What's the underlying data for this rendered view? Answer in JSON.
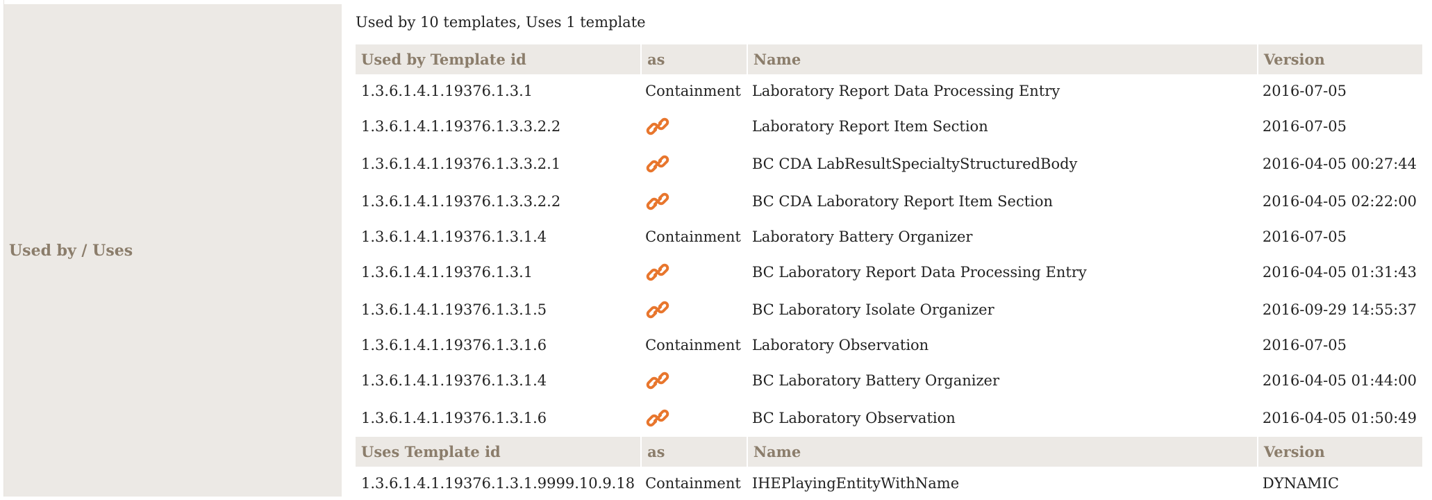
{
  "label": "Used by / Uses",
  "summary": "Used by 10 templates, Uses 1 template",
  "used_by": {
    "headers": [
      "Used by Template id",
      "as",
      "Name",
      "Version"
    ],
    "rows": [
      {
        "id": "1.3.6.1.4.1.19376.1.3.1",
        "as": "Containment",
        "icon": "",
        "name": "Laboratory Report Data Processing Entry",
        "version": "2016-07-05"
      },
      {
        "id": "1.3.6.1.4.1.19376.1.3.3.2.2",
        "as": "",
        "icon": "link-icon",
        "name": "Laboratory Report Item Section",
        "version": "2016-07-05"
      },
      {
        "id": "1.3.6.1.4.1.19376.1.3.3.2.1",
        "as": "",
        "icon": "link-icon",
        "name": "BC CDA LabResultSpecialtyStructuredBody",
        "version": "2016-04-05 00:27:44"
      },
      {
        "id": "1.3.6.1.4.1.19376.1.3.3.2.2",
        "as": "",
        "icon": "link-icon",
        "name": "BC CDA Laboratory Report Item Section",
        "version": "2016-04-05 02:22:00"
      },
      {
        "id": "1.3.6.1.4.1.19376.1.3.1.4",
        "as": "Containment",
        "icon": "",
        "name": "Laboratory Battery Organizer",
        "version": "2016-07-05"
      },
      {
        "id": "1.3.6.1.4.1.19376.1.3.1",
        "as": "",
        "icon": "link-icon",
        "name": "BC Laboratory Report Data Processing Entry",
        "version": "2016-04-05 01:31:43"
      },
      {
        "id": "1.3.6.1.4.1.19376.1.3.1.5",
        "as": "",
        "icon": "link-icon",
        "name": "BC Laboratory Isolate Organizer",
        "version": "2016-09-29 14:55:37"
      },
      {
        "id": "1.3.6.1.4.1.19376.1.3.1.6",
        "as": "Containment",
        "icon": "",
        "name": "Laboratory Observation",
        "version": "2016-07-05"
      },
      {
        "id": "1.3.6.1.4.1.19376.1.3.1.4",
        "as": "",
        "icon": "link-icon",
        "name": "BC Laboratory Battery Organizer",
        "version": "2016-04-05 01:44:00"
      },
      {
        "id": "1.3.6.1.4.1.19376.1.3.1.6",
        "as": "",
        "icon": "link-icon",
        "name": "BC Laboratory Observation",
        "version": "2016-04-05 01:50:49"
      }
    ]
  },
  "uses": {
    "headers": [
      "Uses Template id",
      "as",
      "Name",
      "Version"
    ],
    "rows": [
      {
        "id": "1.3.6.1.4.1.19376.1.3.1.9999.10.9.18",
        "as": "Containment",
        "icon": "",
        "name": "IHEPlayingEntityWithName",
        "version": "DYNAMIC"
      }
    ]
  },
  "colors": {
    "header_bg": "#ece9e5",
    "header_text": "#8b7d6b",
    "link_icon": "#e8762d"
  }
}
